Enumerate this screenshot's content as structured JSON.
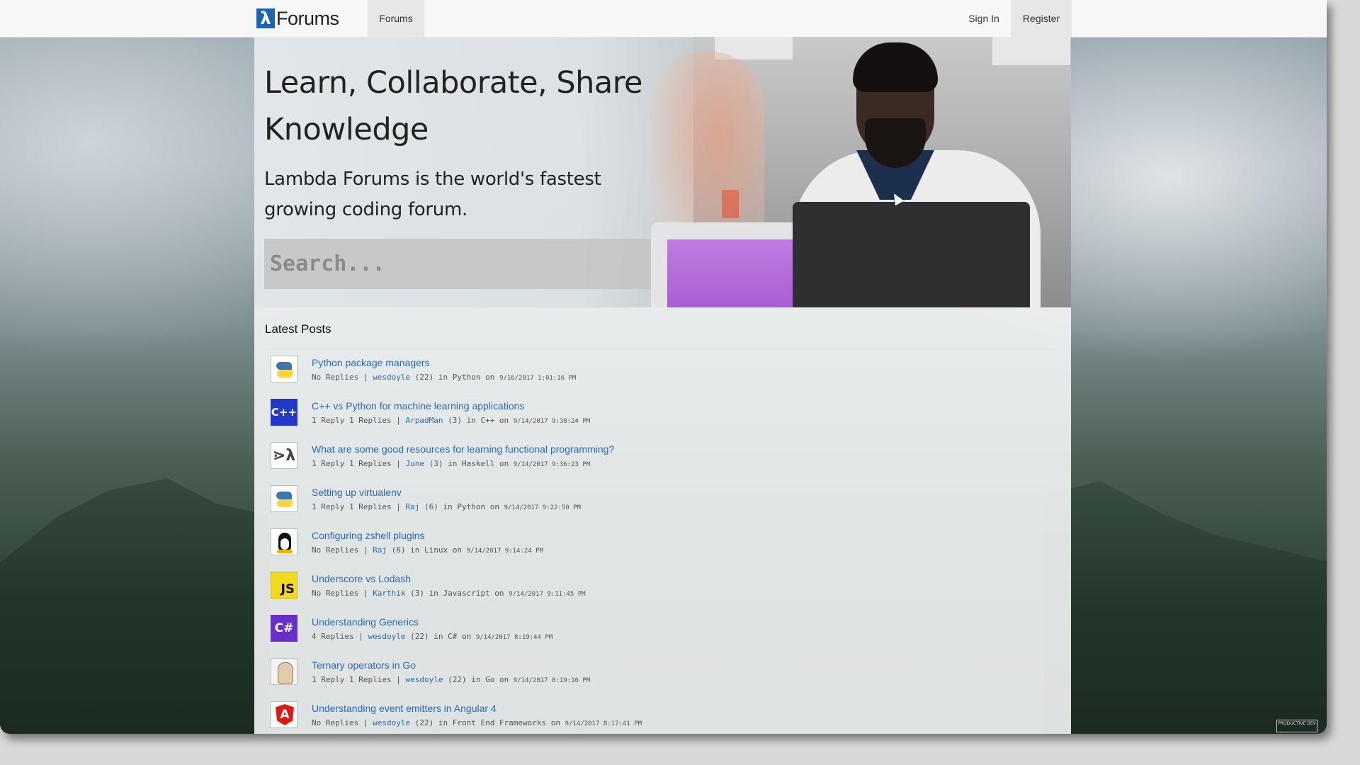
{
  "header": {
    "brand_symbol": "λ",
    "brand_text": "Forums",
    "nav_forums": "Forums",
    "nav_sign_in": "Sign In",
    "nav_register": "Register"
  },
  "hero": {
    "heading": "Learn, Collaborate, Share Knowledge",
    "subheading": "Lambda Forums is the world's fastest growing coding forum.",
    "search_placeholder": "Search..."
  },
  "latest_posts": {
    "title": "Latest Posts",
    "posts": [
      {
        "icon": "python-icon",
        "title": "Python package managers",
        "replies": "No Replies |",
        "author": "wesdoyle",
        "author_rating": "(22)",
        "category": "in Python on",
        "date": "9/16/2017 1:01:16 PM"
      },
      {
        "icon": "cpp-icon",
        "icon_text": "C++",
        "title": "C++ vs Python for machine learning applications",
        "replies": "1 Reply 1 Replies |",
        "author": "ArpadMan",
        "author_rating": "(3)",
        "category": "in C++ on",
        "date": "9/14/2017 9:38:24 PM"
      },
      {
        "icon": "haskell-icon",
        "icon_text": "⋗λ",
        "title": "What are some good resources for learning functional programming?",
        "replies": "1 Reply 1 Replies |",
        "author": "June",
        "author_rating": "(3)",
        "category": "in Haskell on",
        "date": "9/14/2017 9:36:23 PM"
      },
      {
        "icon": "python-icon",
        "title": "Setting up virtualenv",
        "replies": "1 Reply 1 Replies |",
        "author": "Raj",
        "author_rating": "(6)",
        "category": "in Python on",
        "date": "9/14/2017 9:22:50 PM"
      },
      {
        "icon": "linux-icon",
        "title": "Configuring zshell plugins",
        "replies": "No Replies |",
        "author": "Raj",
        "author_rating": "(6)",
        "category": "in Linux on",
        "date": "9/14/2017 9:14:24 PM"
      },
      {
        "icon": "javascript-icon",
        "icon_text": "JS",
        "title": "Underscore vs Lodash",
        "replies": "No Replies |",
        "author": "Karthik",
        "author_rating": "(3)",
        "category": "in Javascript on",
        "date": "9/14/2017 9:11:45 PM"
      },
      {
        "icon": "csharp-icon",
        "icon_text": "C#",
        "title": "Understanding Generics",
        "replies": "4 Replies |",
        "author": "wesdoyle",
        "author_rating": "(22)",
        "category": "in C# on",
        "date": "9/14/2017 8:19:44 PM"
      },
      {
        "icon": "go-icon",
        "title": "Ternary operators in Go",
        "replies": "1 Reply 1 Replies |",
        "author": "wesdoyle",
        "author_rating": "(22)",
        "category": "in Go on",
        "date": "9/14/2017 8:19:16 PM"
      },
      {
        "icon": "angular-icon",
        "icon_text": "A",
        "title": "Understanding event emitters in Angular 4",
        "replies": "No Replies |",
        "author": "wesdoyle",
        "author_rating": "(22)",
        "category": "in Front End Frameworks on",
        "date": "9/14/2017 8:17:41 PM"
      }
    ]
  },
  "watermark": {
    "text": "PRODUCTIVE DEV"
  },
  "colors": {
    "link": "#2a6cae",
    "brand": "#1e63b0",
    "nav_active_bg": "#e7e7e7"
  }
}
